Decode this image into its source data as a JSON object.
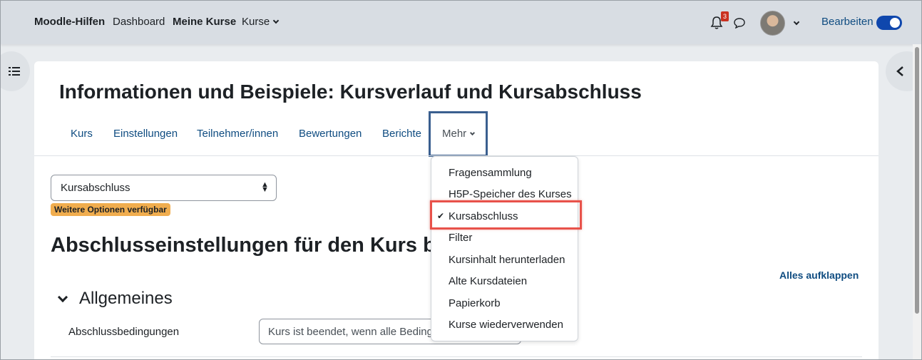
{
  "navbar": {
    "brand": "Moodle-Hilfen",
    "links": [
      "Dashboard",
      "Meine Kurse",
      "Kurse"
    ],
    "notification_count": "3",
    "edit_mode_label": "Bearbeiten",
    "edit_mode_on": true
  },
  "page": {
    "title": "Informationen und Beispiele: Kursverlauf und Kursabschluss",
    "tabs": [
      "Kurs",
      "Einstellungen",
      "Teilnehmer/innen",
      "Bewertungen",
      "Berichte"
    ],
    "more_tab": "Mehr"
  },
  "selector": {
    "value": "Kursabschluss",
    "badge": "Weitere Optionen verfügbar"
  },
  "main": {
    "heading": "Abschlusseinstellungen für den Kurs bearbe",
    "expand_all": "Alles aufklappen",
    "section_title": "Allgemeines",
    "field_label": "Abschlussbedingungen",
    "field_value": "Kurs ist beendet, wenn alle Bedingungen"
  },
  "dropdown": {
    "items": [
      "Fragensammlung",
      "H5P-Speicher des Kurses",
      "Kursabschluss",
      "Filter",
      "Kursinhalt herunterladen",
      "Alte Kursdateien",
      "Papierkorb",
      "Kurse wiederverwenden"
    ],
    "selected": "Kursabschluss"
  },
  "colors": {
    "link": "#0f4c81",
    "highlight": "#e8524a",
    "badge": "#f0ad4e",
    "toggle": "#0f47ad"
  }
}
